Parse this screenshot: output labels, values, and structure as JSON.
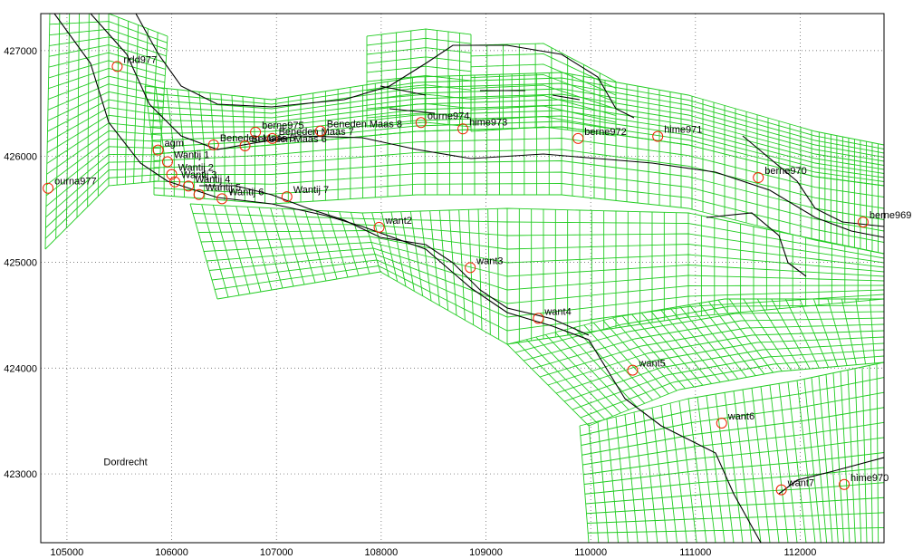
{
  "chart_data": {
    "type": "scatter",
    "xlim": [
      104750,
      112800
    ],
    "ylim": [
      422350,
      427350
    ],
    "x_ticks": [
      105000,
      106000,
      107000,
      108000,
      109000,
      110000,
      111000,
      112000
    ],
    "y_ticks": [
      423000,
      424000,
      425000,
      426000,
      427000
    ],
    "x_tick_labels": [
      "105000",
      "106000",
      "107000",
      "108000",
      "109000",
      "110000",
      "111000",
      "112000"
    ],
    "y_tick_labels": [
      "423000",
      "424000",
      "425000",
      "426000",
      "427000"
    ],
    "grid": "dotted",
    "series_colors": {
      "grid": "#22cc22",
      "banks": "#000000",
      "stations": "#ee2200"
    },
    "region_label": {
      "text": "Dordrecht",
      "x": 105350,
      "y": 423080
    },
    "stations": [
      {
        "label": "ridd977",
        "x": 105480,
        "y": 426850
      },
      {
        "label": "ourna977",
        "x": 104820,
        "y": 425700
      },
      {
        "label": "agm",
        "x": 105870,
        "y": 426060
      },
      {
        "label": "Wantij 1",
        "x": 105960,
        "y": 425950
      },
      {
        "label": "Wantij 2",
        "x": 106000,
        "y": 425830
      },
      {
        "label": "Wantij 3",
        "x": 106030,
        "y": 425760
      },
      {
        "label": "Wantij 4",
        "x": 106160,
        "y": 425720
      },
      {
        "label": "Wantij 5",
        "x": 106260,
        "y": 425640
      },
      {
        "label": "Wantij 6",
        "x": 106480,
        "y": 425600
      },
      {
        "label": "Wantij 7",
        "x": 107100,
        "y": 425620
      },
      {
        "label": "Beneden Maas 5",
        "x": 106400,
        "y": 426110
      },
      {
        "label": "Beneden Maas 6",
        "x": 106700,
        "y": 426100
      },
      {
        "label": "Beneden Maas 7",
        "x": 106960,
        "y": 426170
      },
      {
        "label": "Beneden Maas 8",
        "x": 107420,
        "y": 426240
      },
      {
        "label": "berne975",
        "x": 106800,
        "y": 426230
      },
      {
        "label": "ourne974",
        "x": 108380,
        "y": 426320
      },
      {
        "label": "hime973",
        "x": 108780,
        "y": 426260
      },
      {
        "label": "berne972",
        "x": 109880,
        "y": 426170
      },
      {
        "label": "hime971",
        "x": 110640,
        "y": 426190
      },
      {
        "label": "berne970",
        "x": 111600,
        "y": 425800
      },
      {
        "label": "berne969",
        "x": 112600,
        "y": 425380
      },
      {
        "label": "want2",
        "x": 107980,
        "y": 425330
      },
      {
        "label": "want3",
        "x": 108850,
        "y": 424950
      },
      {
        "label": "want4",
        "x": 109500,
        "y": 424470
      },
      {
        "label": "want5",
        "x": 110400,
        "y": 423980
      },
      {
        "label": "want6",
        "x": 111250,
        "y": 423480
      },
      {
        "label": "want7",
        "x": 111820,
        "y": 422850
      },
      {
        "label": "hime970",
        "x": 112420,
        "y": 422900
      }
    ]
  }
}
